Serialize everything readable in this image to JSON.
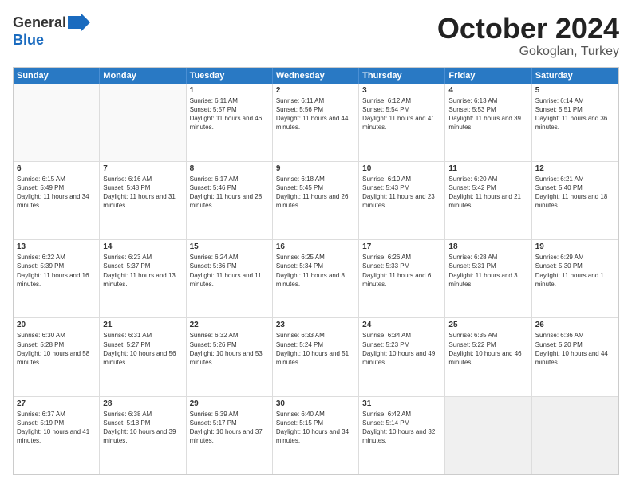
{
  "logo": {
    "general": "General",
    "blue": "Blue"
  },
  "title": {
    "month": "October 2024",
    "location": "Gokoglan, Turkey"
  },
  "calendar": {
    "headers": [
      "Sunday",
      "Monday",
      "Tuesday",
      "Wednesday",
      "Thursday",
      "Friday",
      "Saturday"
    ],
    "rows": [
      [
        {
          "day": "",
          "lines": [],
          "empty": true
        },
        {
          "day": "",
          "lines": [],
          "empty": true
        },
        {
          "day": "1",
          "lines": [
            "Sunrise: 6:11 AM",
            "Sunset: 5:57 PM",
            "Daylight: 11 hours and 46 minutes."
          ]
        },
        {
          "day": "2",
          "lines": [
            "Sunrise: 6:11 AM",
            "Sunset: 5:56 PM",
            "Daylight: 11 hours and 44 minutes."
          ]
        },
        {
          "day": "3",
          "lines": [
            "Sunrise: 6:12 AM",
            "Sunset: 5:54 PM",
            "Daylight: 11 hours and 41 minutes."
          ]
        },
        {
          "day": "4",
          "lines": [
            "Sunrise: 6:13 AM",
            "Sunset: 5:53 PM",
            "Daylight: 11 hours and 39 minutes."
          ]
        },
        {
          "day": "5",
          "lines": [
            "Sunrise: 6:14 AM",
            "Sunset: 5:51 PM",
            "Daylight: 11 hours and 36 minutes."
          ]
        }
      ],
      [
        {
          "day": "6",
          "lines": [
            "Sunrise: 6:15 AM",
            "Sunset: 5:49 PM",
            "Daylight: 11 hours and 34 minutes."
          ]
        },
        {
          "day": "7",
          "lines": [
            "Sunrise: 6:16 AM",
            "Sunset: 5:48 PM",
            "Daylight: 11 hours and 31 minutes."
          ]
        },
        {
          "day": "8",
          "lines": [
            "Sunrise: 6:17 AM",
            "Sunset: 5:46 PM",
            "Daylight: 11 hours and 28 minutes."
          ]
        },
        {
          "day": "9",
          "lines": [
            "Sunrise: 6:18 AM",
            "Sunset: 5:45 PM",
            "Daylight: 11 hours and 26 minutes."
          ]
        },
        {
          "day": "10",
          "lines": [
            "Sunrise: 6:19 AM",
            "Sunset: 5:43 PM",
            "Daylight: 11 hours and 23 minutes."
          ]
        },
        {
          "day": "11",
          "lines": [
            "Sunrise: 6:20 AM",
            "Sunset: 5:42 PM",
            "Daylight: 11 hours and 21 minutes."
          ]
        },
        {
          "day": "12",
          "lines": [
            "Sunrise: 6:21 AM",
            "Sunset: 5:40 PM",
            "Daylight: 11 hours and 18 minutes."
          ]
        }
      ],
      [
        {
          "day": "13",
          "lines": [
            "Sunrise: 6:22 AM",
            "Sunset: 5:39 PM",
            "Daylight: 11 hours and 16 minutes."
          ]
        },
        {
          "day": "14",
          "lines": [
            "Sunrise: 6:23 AM",
            "Sunset: 5:37 PM",
            "Daylight: 11 hours and 13 minutes."
          ]
        },
        {
          "day": "15",
          "lines": [
            "Sunrise: 6:24 AM",
            "Sunset: 5:36 PM",
            "Daylight: 11 hours and 11 minutes."
          ]
        },
        {
          "day": "16",
          "lines": [
            "Sunrise: 6:25 AM",
            "Sunset: 5:34 PM",
            "Daylight: 11 hours and 8 minutes."
          ]
        },
        {
          "day": "17",
          "lines": [
            "Sunrise: 6:26 AM",
            "Sunset: 5:33 PM",
            "Daylight: 11 hours and 6 minutes."
          ]
        },
        {
          "day": "18",
          "lines": [
            "Sunrise: 6:28 AM",
            "Sunset: 5:31 PM",
            "Daylight: 11 hours and 3 minutes."
          ]
        },
        {
          "day": "19",
          "lines": [
            "Sunrise: 6:29 AM",
            "Sunset: 5:30 PM",
            "Daylight: 11 hours and 1 minute."
          ]
        }
      ],
      [
        {
          "day": "20",
          "lines": [
            "Sunrise: 6:30 AM",
            "Sunset: 5:28 PM",
            "Daylight: 10 hours and 58 minutes."
          ]
        },
        {
          "day": "21",
          "lines": [
            "Sunrise: 6:31 AM",
            "Sunset: 5:27 PM",
            "Daylight: 10 hours and 56 minutes."
          ]
        },
        {
          "day": "22",
          "lines": [
            "Sunrise: 6:32 AM",
            "Sunset: 5:26 PM",
            "Daylight: 10 hours and 53 minutes."
          ]
        },
        {
          "day": "23",
          "lines": [
            "Sunrise: 6:33 AM",
            "Sunset: 5:24 PM",
            "Daylight: 10 hours and 51 minutes."
          ]
        },
        {
          "day": "24",
          "lines": [
            "Sunrise: 6:34 AM",
            "Sunset: 5:23 PM",
            "Daylight: 10 hours and 49 minutes."
          ]
        },
        {
          "day": "25",
          "lines": [
            "Sunrise: 6:35 AM",
            "Sunset: 5:22 PM",
            "Daylight: 10 hours and 46 minutes."
          ]
        },
        {
          "day": "26",
          "lines": [
            "Sunrise: 6:36 AM",
            "Sunset: 5:20 PM",
            "Daylight: 10 hours and 44 minutes."
          ]
        }
      ],
      [
        {
          "day": "27",
          "lines": [
            "Sunrise: 6:37 AM",
            "Sunset: 5:19 PM",
            "Daylight: 10 hours and 41 minutes."
          ]
        },
        {
          "day": "28",
          "lines": [
            "Sunrise: 6:38 AM",
            "Sunset: 5:18 PM",
            "Daylight: 10 hours and 39 minutes."
          ]
        },
        {
          "day": "29",
          "lines": [
            "Sunrise: 6:39 AM",
            "Sunset: 5:17 PM",
            "Daylight: 10 hours and 37 minutes."
          ]
        },
        {
          "day": "30",
          "lines": [
            "Sunrise: 6:40 AM",
            "Sunset: 5:15 PM",
            "Daylight: 10 hours and 34 minutes."
          ]
        },
        {
          "day": "31",
          "lines": [
            "Sunrise: 6:42 AM",
            "Sunset: 5:14 PM",
            "Daylight: 10 hours and 32 minutes."
          ]
        },
        {
          "day": "",
          "lines": [],
          "empty": true,
          "shaded": true
        },
        {
          "day": "",
          "lines": [],
          "empty": true,
          "shaded": true
        }
      ]
    ]
  }
}
